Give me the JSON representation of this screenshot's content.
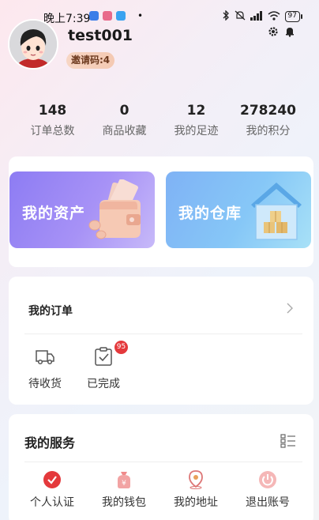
{
  "status_bar": {
    "time": "晚上7:39",
    "battery": "97"
  },
  "profile": {
    "username": "test001",
    "invite_code": "邀请码:4"
  },
  "stats": [
    {
      "value": "148",
      "label": "订单总数"
    },
    {
      "value": "0",
      "label": "商品收藏"
    },
    {
      "value": "12",
      "label": "我的足迹"
    },
    {
      "value": "278240",
      "label": "我的积分"
    }
  ],
  "assets": {
    "my_assets": "我的资产",
    "my_warehouse": "我的仓库"
  },
  "orders": {
    "title": "我的订单",
    "items": [
      {
        "label": "待收货",
        "icon": "truck-icon"
      },
      {
        "label": "已完成",
        "icon": "clipboard-check-icon",
        "badge": "95"
      }
    ]
  },
  "services": {
    "title": "我的服务",
    "items": [
      {
        "label": "个人认证",
        "icon": "verify-check-icon"
      },
      {
        "label": "我的钱包",
        "icon": "wallet-yen-icon"
      },
      {
        "label": "我的地址",
        "icon": "location-pin-icon"
      },
      {
        "label": "退出账号",
        "icon": "power-icon"
      }
    ]
  },
  "colors": {
    "accent_red": "#e4393c",
    "asset_purple": "#8d7cf3",
    "asset_blue": "#7fb2f5"
  }
}
